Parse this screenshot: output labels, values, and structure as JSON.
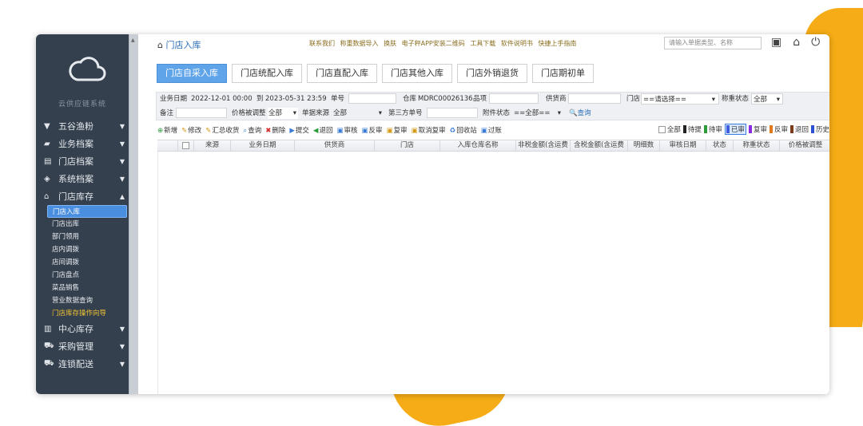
{
  "sidebar": {
    "system_name": "云供应链系统",
    "menus": [
      {
        "icon": "fish-icon",
        "label": "五谷渔粉",
        "arrow": "▼"
      },
      {
        "icon": "archive-icon",
        "label": "业务档案",
        "arrow": "▼"
      },
      {
        "icon": "store-icon",
        "label": "门店档案",
        "arrow": "▼"
      },
      {
        "icon": "system-icon",
        "label": "系统档案",
        "arrow": "▼"
      },
      {
        "icon": "store-stock-icon",
        "label": "门店库存",
        "arrow": "▲"
      }
    ],
    "submenu": [
      "门店入库",
      "门店出库",
      "部门领用",
      "店内调拨",
      "店间调拨",
      "门店盘点",
      "菜品销售",
      "营业数据查询",
      "门店库存操作向导"
    ],
    "menus_after": [
      {
        "icon": "warehouse-icon",
        "label": "中心库存",
        "arrow": "▼"
      },
      {
        "icon": "cart-icon",
        "label": "采购管理",
        "arrow": "▼"
      },
      {
        "icon": "truck-icon",
        "label": "连锁配送",
        "arrow": "▼"
      }
    ]
  },
  "header": {
    "title": "门店入库",
    "links": [
      "联系我们",
      "称重数据导入",
      "换肤",
      "电子秤APP安装二维码",
      "工具下载",
      "软件说明书",
      "快捷上手指南"
    ],
    "search_placeholder": "请输入单据类型、名称"
  },
  "tabs": [
    "门店自采入库",
    "门店统配入库",
    "门店直配入库",
    "门店其他入库",
    "门店外销退货",
    "门店期初单"
  ],
  "filter": {
    "biz_date_label": "业务日期",
    "date_from": "2022-12-01 00:00",
    "date_to_label": "到",
    "date_to": "2023-05-31 23:59",
    "doc_no_label": "单号",
    "warehouse_label": "仓库",
    "warehouse_value": "MDRC00026136",
    "item_label": "品项",
    "supplier_label": "供货商",
    "store_label": "门店",
    "store_value": "==请选择==",
    "weigh_status_label": "称重状态",
    "weigh_status_value": "全部",
    "remark_label": "备注",
    "price_adjust_label": "价格被调整",
    "price_adjust_value": "全部",
    "source_label": "单据来源",
    "source_value": "全部",
    "third_no_label": "第三方单号",
    "attach_status_label": "附件状态",
    "attach_status_value": "==全部==",
    "query_label": "查询"
  },
  "toolbar": {
    "buttons": [
      {
        "icon": "plus-icon",
        "label": "新增",
        "color": "#2e9b3b"
      },
      {
        "icon": "edit-icon",
        "label": "修改",
        "color": "#d49a1a"
      },
      {
        "icon": "merge-icon",
        "label": "汇总收货",
        "color": "#d49a1a"
      },
      {
        "icon": "search-icon",
        "label": "查询",
        "color": "#3a7bd5"
      },
      {
        "icon": "delete-icon",
        "label": "删除",
        "color": "#d42b2b"
      },
      {
        "icon": "submit-icon",
        "label": "提交",
        "color": "#3a7bd5"
      },
      {
        "icon": "back-icon",
        "label": "退回",
        "color": "#2e9b3b"
      },
      {
        "icon": "audit-icon",
        "label": "审核",
        "color": "#3a7bd5"
      },
      {
        "icon": "unaudit-icon",
        "label": "反审",
        "color": "#3a7bd5"
      },
      {
        "icon": "recheck-icon",
        "label": "复审",
        "color": "#d49a1a"
      },
      {
        "icon": "cancel-recheck-icon",
        "label": "取消复审",
        "color": "#d49a1a"
      },
      {
        "icon": "recycle-icon",
        "label": "回收站",
        "color": "#3a7bd5"
      },
      {
        "icon": "filter-icon",
        "label": "过账",
        "color": "#3a7bd5"
      }
    ],
    "status_filters": [
      {
        "label": "全部",
        "color": "#ffffff"
      },
      {
        "label": "待提",
        "color": "#222222"
      },
      {
        "label": "待审",
        "color": "#2e9b3b"
      },
      {
        "label": "已审",
        "color": "#3c5de0"
      },
      {
        "label": "复审",
        "color": "#8a2be2"
      },
      {
        "label": "反审",
        "color": "#e07a1a"
      },
      {
        "label": "退回",
        "color": "#7a3b1a"
      },
      {
        "label": "历史",
        "color": "#2b4fd6"
      }
    ]
  },
  "grid": {
    "columns": [
      "来源",
      "业务日期",
      "供货商",
      "门店",
      "入库仓库名称",
      "非税金额(含运费",
      "含税金额(含运费",
      "明细数",
      "审核日期",
      "状态",
      "称重状态",
      "价格被调整"
    ]
  }
}
